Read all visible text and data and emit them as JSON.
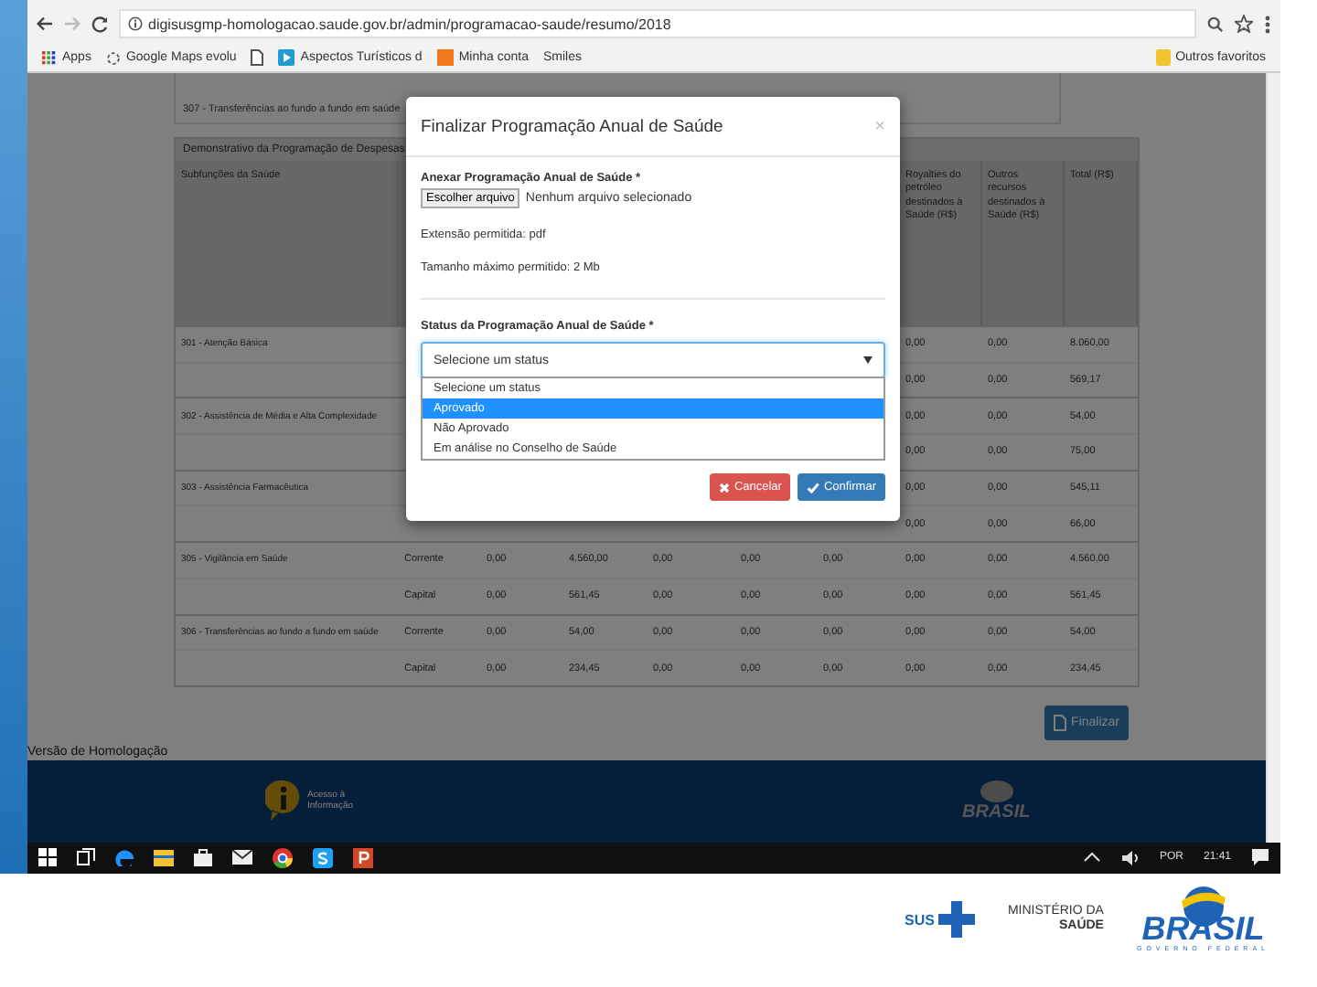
{
  "browser": {
    "url": "digisusgmp-homologacao.saude.gov.br/admin/programacao-saude/resumo/2018",
    "bookmarks": [
      {
        "label": "Apps",
        "kind": "apps"
      },
      {
        "label": "Google Maps evolu",
        "kind": "maps"
      },
      {
        "kind": "doc"
      },
      {
        "label": "Aspectos Turísticos d",
        "kind": "blue"
      },
      {
        "label": "Minha conta",
        "kind": "orange"
      },
      {
        "label": "Smiles",
        "kind": "none"
      }
    ],
    "other_bookmarks": "Outros favoritos"
  },
  "page": {
    "top_row": "307 - Transferências ao fundo a fundo em saúde",
    "table": {
      "title": "Demonstrativo da Programação de Despesas",
      "columns": [
        "Subfunções da Saúde",
        null,
        null,
        null,
        null,
        null,
        null,
        "Royalties do petróleo destinados à Saúde (R$)",
        "Outros recursos destinados à Saúde (R$)",
        "Total (R$)"
      ],
      "rows": [
        {
          "cells": [
            "301 - Atenção Básica",
            null,
            null,
            null,
            null,
            null,
            null,
            "0,00",
            "0,00",
            "8.060,00"
          ]
        },
        {
          "cells": [
            "",
            null,
            null,
            null,
            null,
            null,
            null,
            "0,00",
            "0,00",
            "569,17"
          ]
        },
        {
          "cells": [
            "302 - Assistência de Média e Alta Complexidade",
            null,
            null,
            null,
            null,
            null,
            null,
            "0,00",
            "0,00",
            "54,00"
          ]
        },
        {
          "cells": [
            "",
            null,
            null,
            null,
            null,
            null,
            null,
            "0,00",
            "0,00",
            "75,00"
          ]
        },
        {
          "cells": [
            "303 - Assistência Farmacêutica",
            null,
            null,
            null,
            null,
            null,
            null,
            "0,00",
            "0,00",
            "545,11"
          ]
        },
        {
          "cells": [
            "",
            null,
            null,
            null,
            null,
            null,
            null,
            "0,00",
            "0,00",
            "66,00"
          ]
        },
        {
          "cells": [
            "305 - Vigilância em Saúde",
            "Corrente",
            "0,00",
            "4.560,00",
            "0,00",
            "0,00",
            "0,00",
            "0,00",
            "0,00",
            "4.560,00"
          ]
        },
        {
          "cells": [
            "",
            "Capital",
            "0,00",
            "561,45",
            "0,00",
            "0,00",
            "0,00",
            "0,00",
            "0,00",
            "561,45"
          ]
        },
        {
          "cells": [
            "306 - Transferências ao fundo a fundo em saúde",
            "Corrente",
            "0,00",
            "54,00",
            "0,00",
            "0,00",
            "0,00",
            "0,00",
            "0,00",
            "54,00"
          ]
        },
        {
          "cells": [
            "",
            "Capital",
            "0,00",
            "234,45",
            "0,00",
            "0,00",
            "0,00",
            "0,00",
            "0,00",
            "234,45"
          ]
        }
      ]
    },
    "finalize_button": "Finalizar",
    "version": "Versão de Homologação",
    "footer": {
      "info_logo": "Acesso à Informação",
      "brasil_logo": "BRASIL"
    }
  },
  "modal": {
    "title": "Finalizar Programação Anual de Saúde",
    "close": "×",
    "attach_label": "Anexar Programação Anual de Saúde *",
    "file_button": "Escolher arquivo",
    "file_status": "Nenhum arquivo selecionado",
    "hints": [
      "Extensão permitida: pdf",
      "Tamanho máximo permitido: 2 Mb"
    ],
    "status_label": "Status da Programação Anual de Saúde *",
    "select_value": "Selecione um status",
    "options": [
      {
        "label": "Selecione um status",
        "selected": false
      },
      {
        "label": "Aprovado",
        "selected": true
      },
      {
        "label": "Não Aprovado",
        "selected": false
      },
      {
        "label": "Em análise no Conselho de Saúde",
        "selected": false
      }
    ],
    "cancel": "Cancelar",
    "confirm": "Confirmar"
  },
  "taskbar": {
    "apps": [
      {
        "kind": "start"
      },
      {
        "kind": "taskview"
      },
      {
        "kind": "edge"
      },
      {
        "kind": "folder"
      },
      {
        "kind": "store"
      },
      {
        "kind": "mail"
      },
      {
        "kind": "chrome"
      },
      {
        "kind": "skype"
      },
      {
        "kind": "powerpoint"
      }
    ],
    "language": "POR",
    "time": "21:41"
  },
  "slide_footer": {
    "sus": "SUS",
    "ministry_line1": "MINISTÉRIO DA",
    "ministry_line2": "SAÚDE",
    "brasil": "BRASIL",
    "government": "GOVERNO FEDERAL"
  }
}
